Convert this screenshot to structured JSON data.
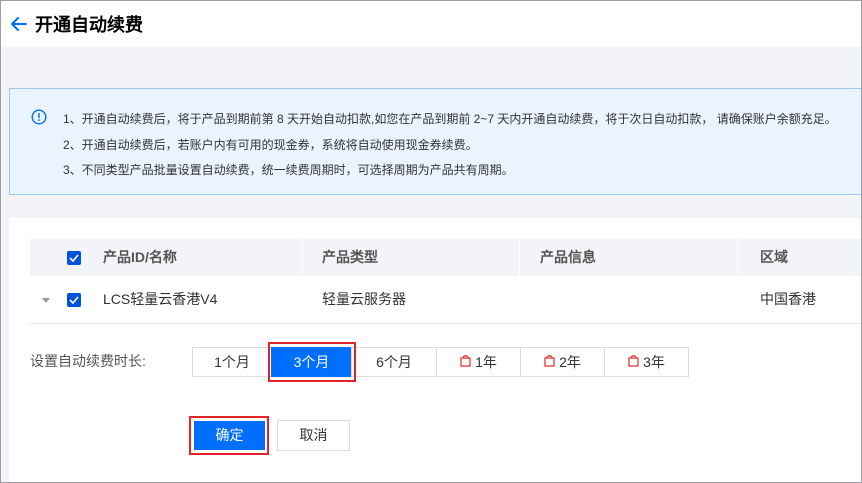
{
  "header": {
    "title": "开通自动续费"
  },
  "notice": {
    "lines": [
      "1、开通自动续费后，将于产品到期前第 8 天开始自动扣款,如您在产品到期前 2~7 天内开通自动续费，将于次日自动扣款， 请确保账户余额充足。",
      "2、开通自动续费后，若账户内有可用的现金券，系统将自动使用现金券续费。",
      "3、不同类型产品批量设置自动续费，统一续费周期时，可选择周期为产品共有周期。"
    ]
  },
  "table": {
    "columns": [
      "产品ID/名称",
      "产品类型",
      "产品信息",
      "区域"
    ],
    "rows": [
      {
        "name": "LCS轻量云香港V4",
        "type": "轻量云服务器",
        "info": "",
        "region": "中国香港",
        "checked": true
      }
    ],
    "all_checked": true
  },
  "period": {
    "label": "设置自动续费时长:",
    "options": [
      {
        "label": "1个月",
        "icon": "",
        "active": false
      },
      {
        "label": "3个月",
        "icon": "",
        "active": true
      },
      {
        "label": "6个月",
        "icon": "",
        "active": false
      },
      {
        "label": "1年",
        "icon": "gift-icon",
        "active": false
      },
      {
        "label": "2年",
        "icon": "gift-icon",
        "active": false
      },
      {
        "label": "3年",
        "icon": "gift-icon",
        "active": false
      }
    ]
  },
  "actions": {
    "confirm_label": "确定",
    "cancel_label": "取消"
  },
  "colors": {
    "primary": "#006eff",
    "highlight": "#e0242c",
    "notice_bg": "#eaf4ff",
    "gift": "#e54545"
  }
}
